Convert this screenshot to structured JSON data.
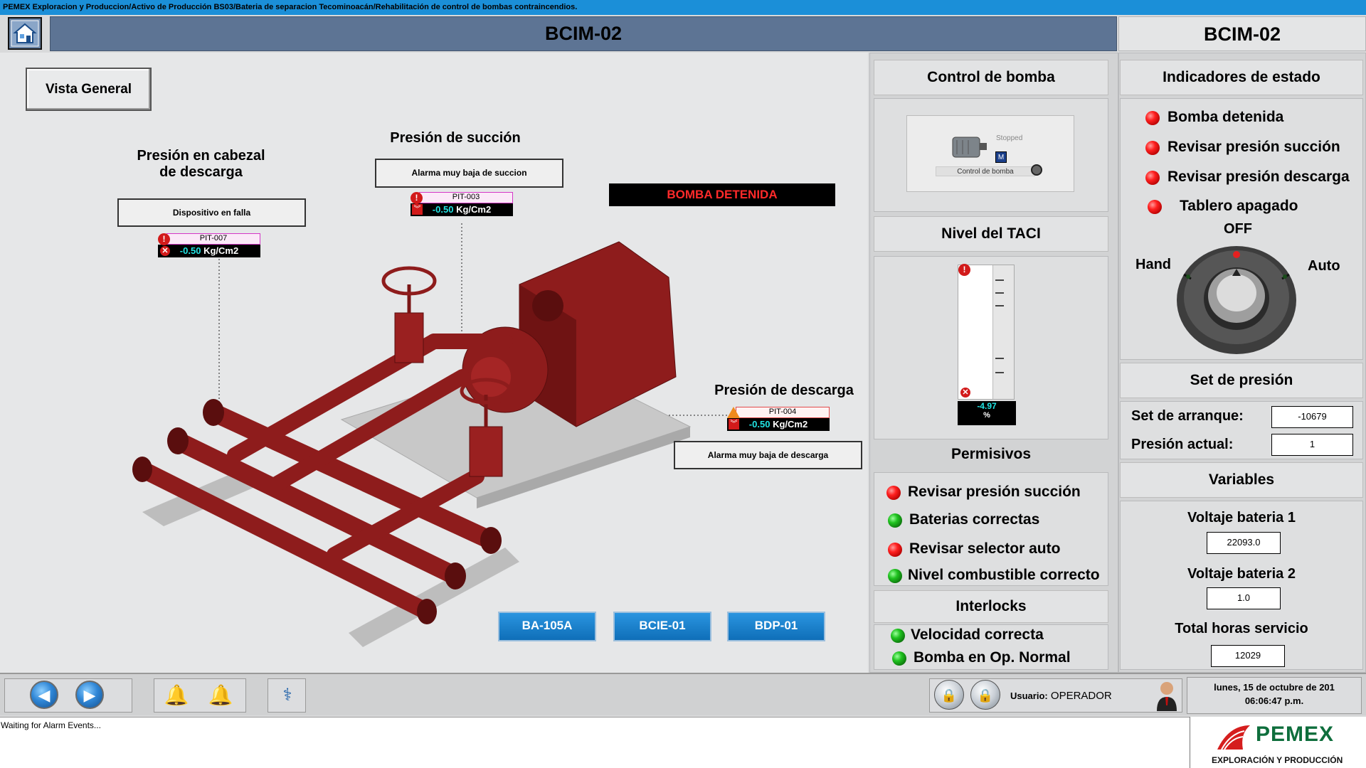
{
  "window": {
    "path": "PEMEX Exploracion y Produccion/Activo de Producción BS03/Bateria de separacion Tecominoacán/Rehabilitación de control de bombas contraincendios."
  },
  "header": {
    "title": "BCIM-02",
    "right_title": "BCIM-02"
  },
  "main": {
    "vista_general": "Vista General",
    "presion_cabezal_line1": "Presión en cabezal",
    "presion_cabezal_line2": "de descarga",
    "presion_cabezal_alarm": "Dispositivo en falla",
    "pit007": {
      "name": "PIT-007",
      "value": "-0.50",
      "unit": "Kg/Cm2"
    },
    "presion_succion": "Presión de succión",
    "presion_succion_alarm": "Alarma muy baja de succion",
    "pit003": {
      "name": "PIT-003",
      "value": "-0.50",
      "unit": "Kg/Cm2"
    },
    "bomba_status": "BOMBA DETENIDA",
    "presion_descarga": "Presión de descarga",
    "pit004": {
      "name": "PIT-004",
      "value": "-0.50",
      "unit": "Kg/Cm2"
    },
    "presion_descarga_alarm": "Alarma muy baja de descarga",
    "nav_buttons": [
      "BA-105A",
      "BCIE-01",
      "BDP-01"
    ]
  },
  "control_bomba": {
    "title": "Control de bomba",
    "motor_state": "Stopped",
    "motor_label": "Control de bomba"
  },
  "nivel_taci": {
    "title": "Nivel del TACI",
    "value": "-4.97",
    "unit": "%"
  },
  "permisivos": {
    "title": "Permisivos",
    "items": [
      {
        "label": "Revisar presión succión",
        "state": "red"
      },
      {
        "label": "Baterias correctas",
        "state": "green"
      },
      {
        "label": "Revisar selector auto",
        "state": "red"
      },
      {
        "label": "Nivel combustible correcto",
        "state": "green"
      }
    ]
  },
  "interlocks": {
    "title": "Interlocks",
    "items": [
      {
        "label": "Velocidad correcta",
        "state": "green"
      },
      {
        "label": "Bomba en Op. Normal",
        "state": "green"
      }
    ]
  },
  "indicadores": {
    "title": "Indicadores de estado",
    "items": [
      {
        "label": "Bomba detenida",
        "state": "red"
      },
      {
        "label": "Revisar presión succión",
        "state": "red"
      },
      {
        "label": "Revisar presión descarga",
        "state": "red"
      },
      {
        "label": "Tablero apagado",
        "state": "red"
      }
    ],
    "selector": {
      "off": "OFF",
      "hand": "Hand",
      "auto": "Auto"
    }
  },
  "set_presion": {
    "title": "Set de presión",
    "arranque_label": "Set de arranque:",
    "arranque_value": "-10679",
    "actual_label": "Presión actual:",
    "actual_value": "1"
  },
  "variables": {
    "title": "Variables",
    "v1_label": "Voltaje bateria 1",
    "v1_value": "22093.0",
    "v2_label": "Voltaje bateria 2",
    "v2_value": "1.0",
    "horas_label": "Total horas servicio",
    "horas_value": "12029"
  },
  "bottom": {
    "usuario_label": "Usuario:",
    "usuario_value": "OPERADOR",
    "date": "lunes, 15 de octubre de 201",
    "time": "06:06:47 p.m."
  },
  "status": {
    "text": "Waiting for Alarm Events..."
  },
  "logo": {
    "brand": "PEMEX",
    "sub": "EXPLORACIÓN Y PRODUCCIÓN"
  },
  "colors": {
    "accent_blue": "#1b8fd8",
    "header_blue": "#5d7494",
    "pipe_red": "#8e1c1c",
    "alarm_red": "#d21a1a",
    "ok_green": "#1fc21f"
  }
}
